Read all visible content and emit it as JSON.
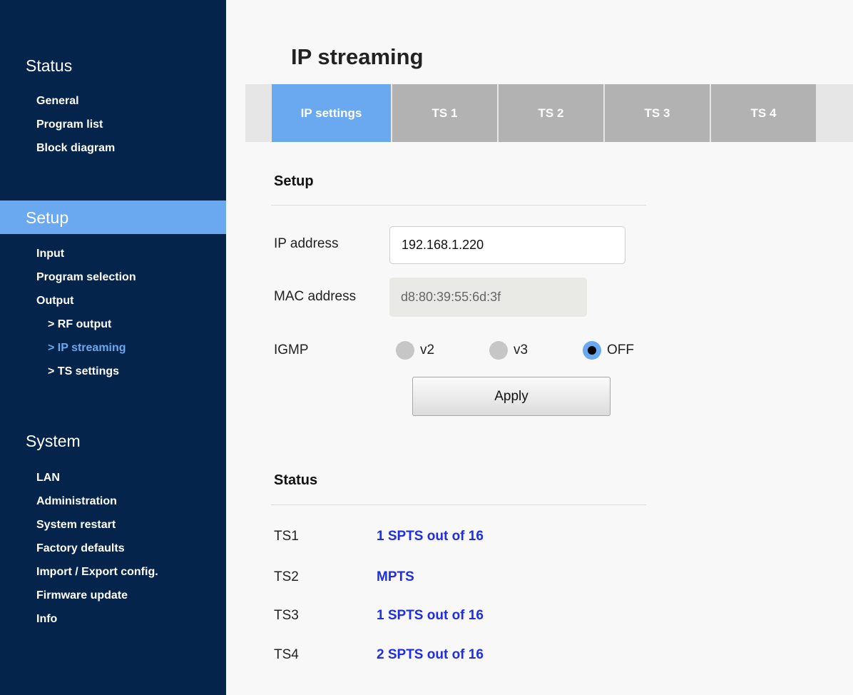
{
  "sidebar": {
    "status_title": "Status",
    "status_items": [
      "General",
      "Program list",
      "Block diagram"
    ],
    "setup_title": "Setup",
    "setup_items": [
      "Input",
      "Program selection",
      "Output"
    ],
    "output_sub_items": [
      "> RF output",
      "> IP streaming",
      "> TS settings"
    ],
    "system_title": "System",
    "system_items": [
      "LAN",
      "Administration",
      "System restart",
      "Factory defaults",
      "Import / Export config.",
      "Firmware update",
      "Info"
    ]
  },
  "page": {
    "title": "IP streaming",
    "tabs": [
      "IP settings",
      "TS 1",
      "TS 2",
      "TS 3",
      "TS 4"
    ],
    "active_tab": "IP settings"
  },
  "setup": {
    "heading": "Setup",
    "ip_label": "IP address",
    "ip_value": "192.168.1.220",
    "mac_label": "MAC address",
    "mac_value": "d8:80:39:55:6d:3f",
    "igmp_label": "IGMP",
    "igmp_options": [
      "v2",
      "v3",
      "OFF"
    ],
    "igmp_selected": "OFF",
    "apply_label": "Apply"
  },
  "status": {
    "heading": "Status",
    "rows": [
      {
        "ts": "TS1",
        "value": "1 SPTS out of 16"
      },
      {
        "ts": "TS2",
        "value": "MPTS"
      },
      {
        "ts": "TS3",
        "value": "1 SPTS out of 16"
      },
      {
        "ts": "TS4",
        "value": "2 SPTS out of 16"
      }
    ]
  },
  "colors": {
    "sidebar_bg": "#05244b",
    "accent": "#6aa8f0",
    "tab_inactive": "#b2b2b2",
    "status_value": "#1e2ee0"
  }
}
